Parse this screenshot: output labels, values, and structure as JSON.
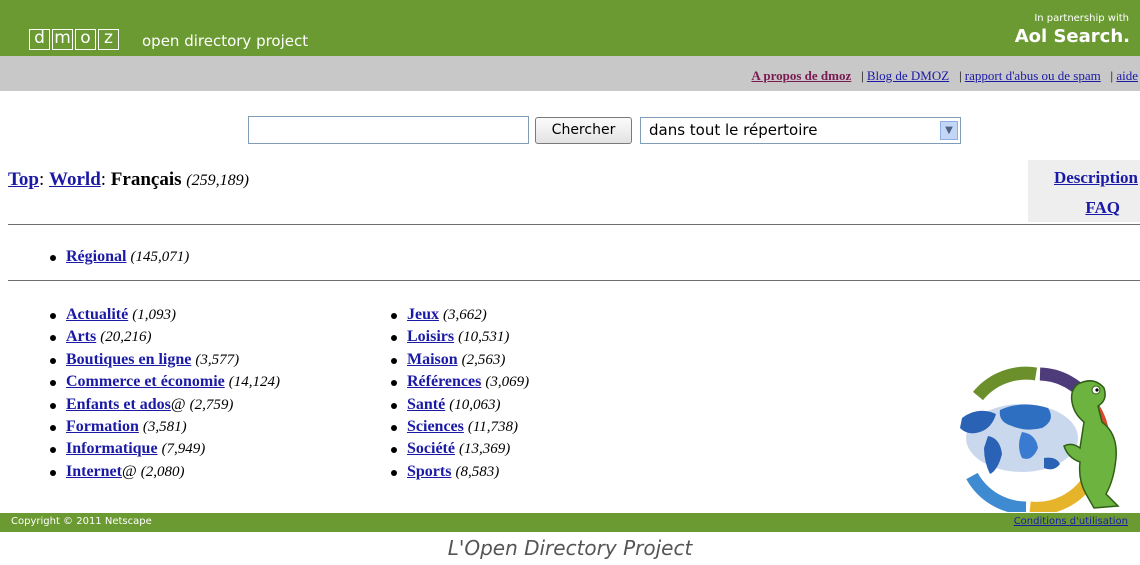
{
  "header": {
    "logo_letters": [
      "d",
      "m",
      "o",
      "z"
    ],
    "tagline": "open directory project",
    "partner_text": "In partnership with",
    "partner_brand": "Aol Search."
  },
  "toplinks": {
    "about": "A propos de dmoz",
    "blog": "Blog de DMOZ",
    "abuse": "rapport d'abus ou de spam",
    "help": "aide",
    "separator": "|"
  },
  "search": {
    "input_value": "",
    "button_label": "Chercher",
    "scope_selected": "dans tout le répertoire"
  },
  "breadcrumb": {
    "top": "Top",
    "world": "World",
    "current": "Français",
    "count": "(259,189)"
  },
  "side": {
    "description": "Description",
    "faq": "FAQ"
  },
  "regional": {
    "label": "Régional",
    "count": "(145,071)"
  },
  "categories_left": [
    {
      "label": "Actualité",
      "at": "",
      "count": "(1,093)"
    },
    {
      "label": "Arts",
      "at": "",
      "count": "(20,216)"
    },
    {
      "label": "Boutiques en ligne",
      "at": "",
      "count": "(3,577)"
    },
    {
      "label": "Commerce et économie",
      "at": "",
      "count": "(14,124)"
    },
    {
      "label": "Enfants et ados",
      "at": "@",
      "count": "(2,759)"
    },
    {
      "label": "Formation",
      "at": "",
      "count": "(3,581)"
    },
    {
      "label": "Informatique",
      "at": "",
      "count": "(7,949)"
    },
    {
      "label": "Internet",
      "at": "@",
      "count": "(2,080)"
    }
  ],
  "categories_right": [
    {
      "label": "Jeux",
      "at": "",
      "count": "(3,662)"
    },
    {
      "label": "Loisirs",
      "at": "",
      "count": "(10,531)"
    },
    {
      "label": "Maison",
      "at": "",
      "count": "(2,563)"
    },
    {
      "label": "Références",
      "at": "",
      "count": "(3,069)"
    },
    {
      "label": "Santé",
      "at": "",
      "count": "(10,063)"
    },
    {
      "label": "Sciences",
      "at": "",
      "count": "(11,738)"
    },
    {
      "label": "Société",
      "at": "",
      "count": "(13,369)"
    },
    {
      "label": "Sports",
      "at": "",
      "count": "(8,583)"
    }
  ],
  "footer": {
    "copyright": "Copyright © 2011 Netscape",
    "terms": "Conditions d'utilisation"
  },
  "caption": "L'Open Directory Project",
  "colors": {
    "header_green": "#6b9a32",
    "link_blue": "#1a1aa6",
    "linkbar_gray": "#c8c8c8"
  }
}
